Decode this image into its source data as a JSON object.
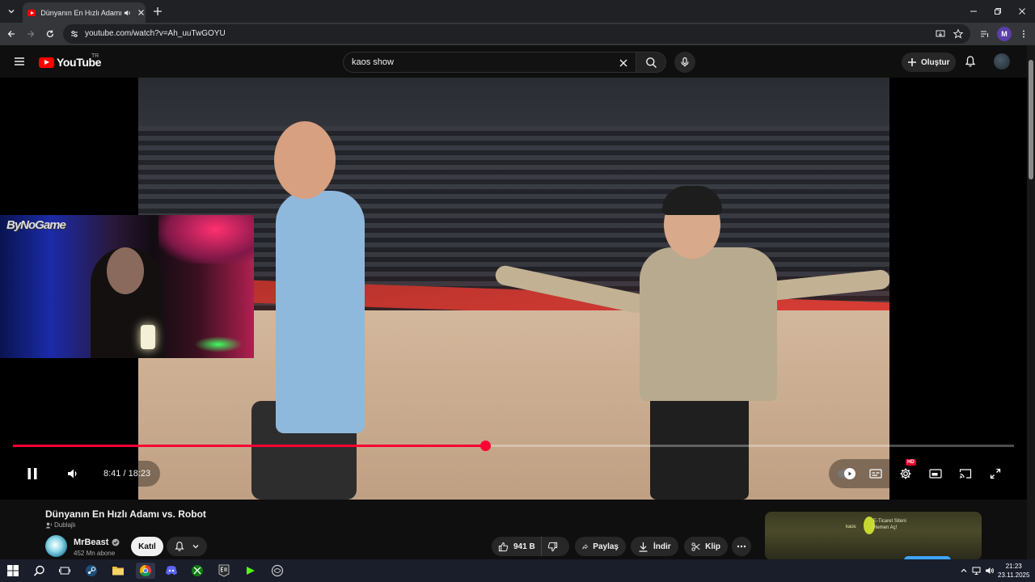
{
  "browser": {
    "tab_title": "Dünyanın En Hızlı Adamı vs.",
    "url": "youtube.com/watch?v=Ah_uuTwGOYU",
    "profile_initial": "M"
  },
  "youtube": {
    "logo_text": "YouTube",
    "country_code": "TR",
    "search_query": "kaos show",
    "create_label": "Oluştur"
  },
  "player": {
    "time_current": "8:41",
    "time_total": "18:23",
    "time_display": "8:41 / 18:23",
    "progress_fraction": 0.472,
    "quality_badge": "HD",
    "overlay_logo": "ByNoGame"
  },
  "video": {
    "title": "Dünyanın En Hızlı Adamı vs. Robot",
    "dub_label": "Dublajlı",
    "channel_name": "MrBeast",
    "subscribers": "452 Mn abone",
    "join_label": "Katıl",
    "likes": "941 B",
    "share_label": "Paylaş",
    "download_label": "İndir",
    "clip_label": "Klip"
  },
  "ad": {
    "brand": "kaos",
    "title_line1": "E-Ticaret Siteni",
    "title_line2": "Hemen Aç!"
  },
  "taskbar": {
    "time": "21:23",
    "date": "23.11.2025"
  },
  "colors": {
    "accent": "#ff0033",
    "background": "#0f0f0f",
    "chip": "#272727"
  }
}
